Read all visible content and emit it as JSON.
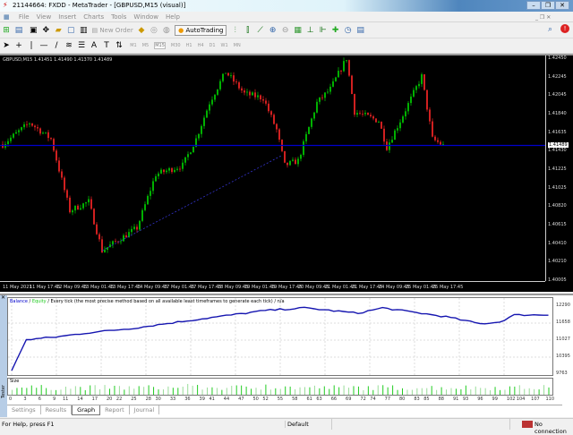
{
  "window": {
    "title": "21144664: FXDD - MetaTrader - [GBPUSD,M15 (visual)]"
  },
  "menu": [
    "File",
    "View",
    "Insert",
    "Charts",
    "Tools",
    "Window",
    "Help"
  ],
  "toolbar": {
    "new_order": "New Order",
    "autotrading": "AutoTrading",
    "timeframes": [
      "M1",
      "M5",
      "M15",
      "M30",
      "H1",
      "H4",
      "D1",
      "W1",
      "MN"
    ],
    "active_timeframe": "M15"
  },
  "chart": {
    "info": "GBPUSD,M15  1.41451 1.41490 1.41370 1.41489",
    "current_price": 1.41489,
    "current_price_label": "1.41489",
    "price_labels": [
      "1.42450",
      "1.42245",
      "1.42045",
      "1.41840",
      "1.41635",
      "1.41430",
      "1.41225",
      "1.41025",
      "1.40820",
      "1.40615",
      "1.40410",
      "1.40210",
      "1.40005"
    ],
    "price_range": [
      1.40005,
      1.4245
    ],
    "time_labels": [
      "11 May 2021",
      "11 May 17:45",
      "12 May 09:45",
      "13 May 01:45",
      "13 May 17:45",
      "14 May 09:45",
      "17 May 01:45",
      "17 May 17:45",
      "18 May 09:45",
      "19 May 01:45",
      "19 May 17:45",
      "20 May 09:45",
      "21 May 01:45",
      "21 May 17:45",
      "24 May 09:45",
      "25 May 01:45",
      "25 May 17:45"
    ],
    "price_path": [
      [
        0,
        1.415
      ],
      [
        10,
        1.4174
      ],
      [
        18,
        1.4156
      ],
      [
        25,
        1.4077
      ],
      [
        32,
        1.4087
      ],
      [
        37,
        1.4033
      ],
      [
        50,
        1.4058
      ],
      [
        57,
        1.4117
      ],
      [
        67,
        1.4127
      ],
      [
        72,
        1.4156
      ],
      [
        77,
        1.4196
      ],
      [
        83,
        1.423
      ],
      [
        90,
        1.4206
      ],
      [
        97,
        1.4201
      ],
      [
        102,
        1.4166
      ],
      [
        105,
        1.4127
      ],
      [
        110,
        1.4132
      ],
      [
        117,
        1.4196
      ],
      [
        122,
        1.4211
      ],
      [
        128,
        1.4245
      ],
      [
        131,
        1.4186
      ],
      [
        140,
        1.4176
      ],
      [
        143,
        1.4147
      ],
      [
        148,
        1.4176
      ],
      [
        156,
        1.4225
      ],
      [
        160,
        1.4156
      ],
      [
        164,
        1.41489
      ]
    ],
    "colors": {
      "bull": "#00b000",
      "bear": "#d02020",
      "line": "#0000cc"
    }
  },
  "tester": {
    "header": {
      "balance": "Balance",
      "sep1": " / ",
      "equity": "Equity",
      "rest": " / Every tick (the most precise method based on all available least timeframes to generate each tick) / n/a"
    },
    "balance_labels": [
      "12290",
      "11658",
      "11027",
      "10395",
      "9763"
    ],
    "balance_range": [
      9763,
      12290
    ],
    "balance_path": [
      [
        0,
        9894
      ],
      [
        3,
        11043
      ],
      [
        9,
        11141
      ],
      [
        16,
        11306
      ],
      [
        25,
        11470
      ],
      [
        34,
        11699
      ],
      [
        52,
        12126
      ],
      [
        60,
        12224
      ],
      [
        71,
        12027
      ],
      [
        76,
        12224
      ],
      [
        89,
        11896
      ],
      [
        96,
        11634
      ],
      [
        100,
        11699
      ],
      [
        103,
        11962
      ],
      [
        110,
        11962
      ]
    ],
    "size_label": "Size",
    "x_labels": [
      "0",
      "3",
      "6",
      "9",
      "11",
      "14",
      "17",
      "20",
      "22",
      "25",
      "28",
      "30",
      "33",
      "36",
      "39",
      "41",
      "44",
      "47",
      "50",
      "52",
      "55",
      "58",
      "61",
      "63",
      "66",
      "69",
      "72",
      "74",
      "77",
      "80",
      "83",
      "85",
      "88",
      "91",
      "93",
      "96",
      "99",
      "102",
      "104",
      "107",
      "110"
    ],
    "tabs": [
      "Settings",
      "Results",
      "Graph",
      "Report",
      "Journal"
    ],
    "active_tab": "Graph",
    "side_label": "Tester"
  },
  "status": {
    "help": "For Help, press F1",
    "profile": "Default",
    "connection": "No connection"
  }
}
